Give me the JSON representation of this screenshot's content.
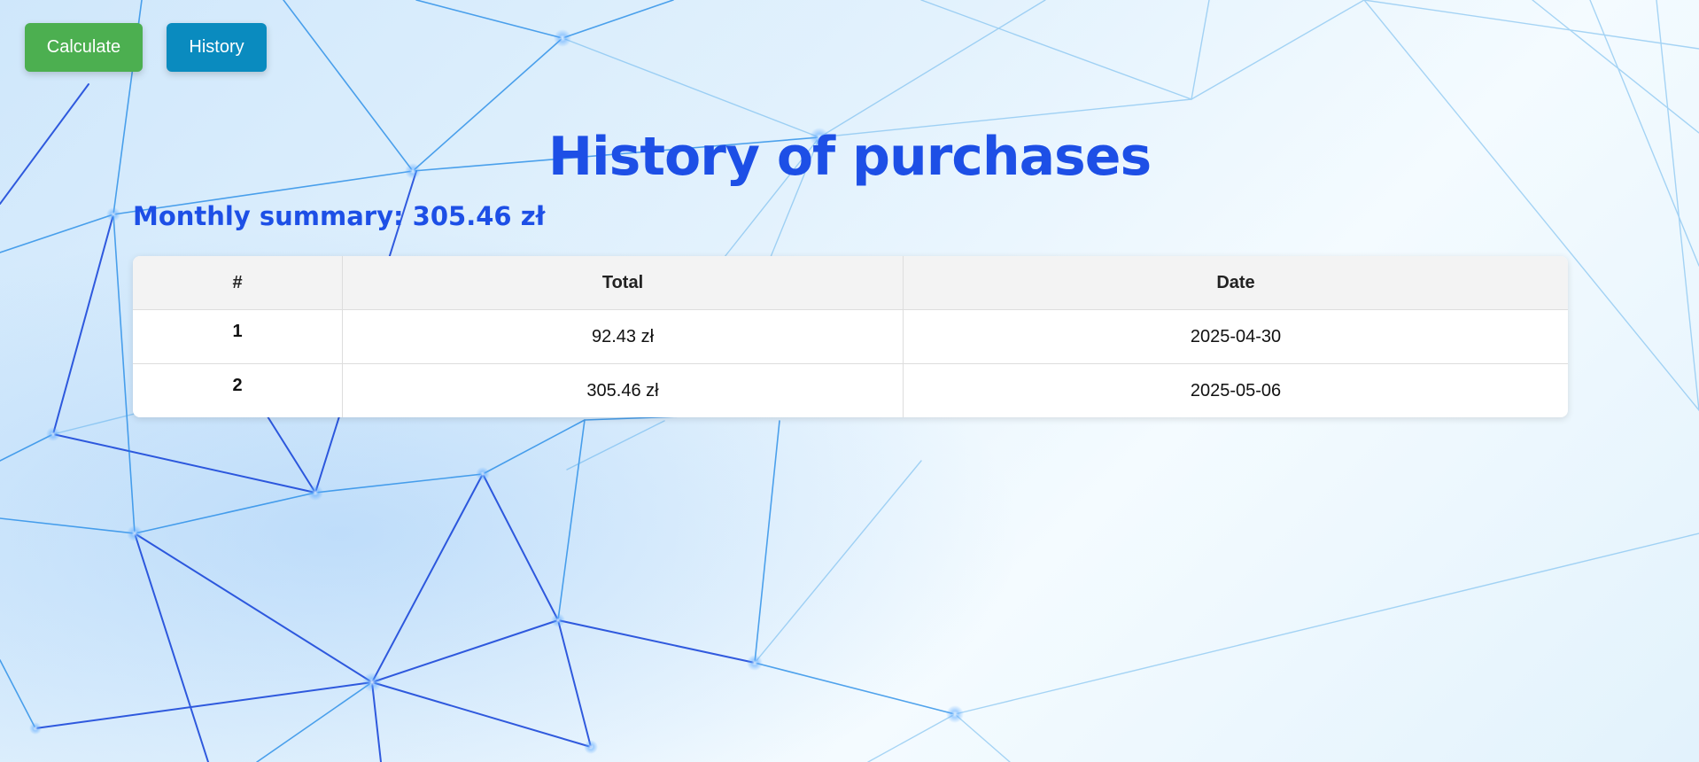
{
  "toolbar": {
    "calculate_label": "Calculate",
    "history_label": "History"
  },
  "page": {
    "title": "History of purchases",
    "summary": "Monthly summary: 305.46 zł"
  },
  "table": {
    "headers": [
      "#",
      "Total",
      "Date"
    ],
    "rows": [
      {
        "index": "1",
        "total": "92.43 zł",
        "date": "2025-04-30"
      },
      {
        "index": "2",
        "total": "305.46 zł",
        "date": "2025-05-06"
      }
    ]
  },
  "colors": {
    "calculate_button": "#4caf50",
    "history_button": "#0a8bbf",
    "heading": "#1d4fe6",
    "network_lines": "#1e6fe0"
  }
}
